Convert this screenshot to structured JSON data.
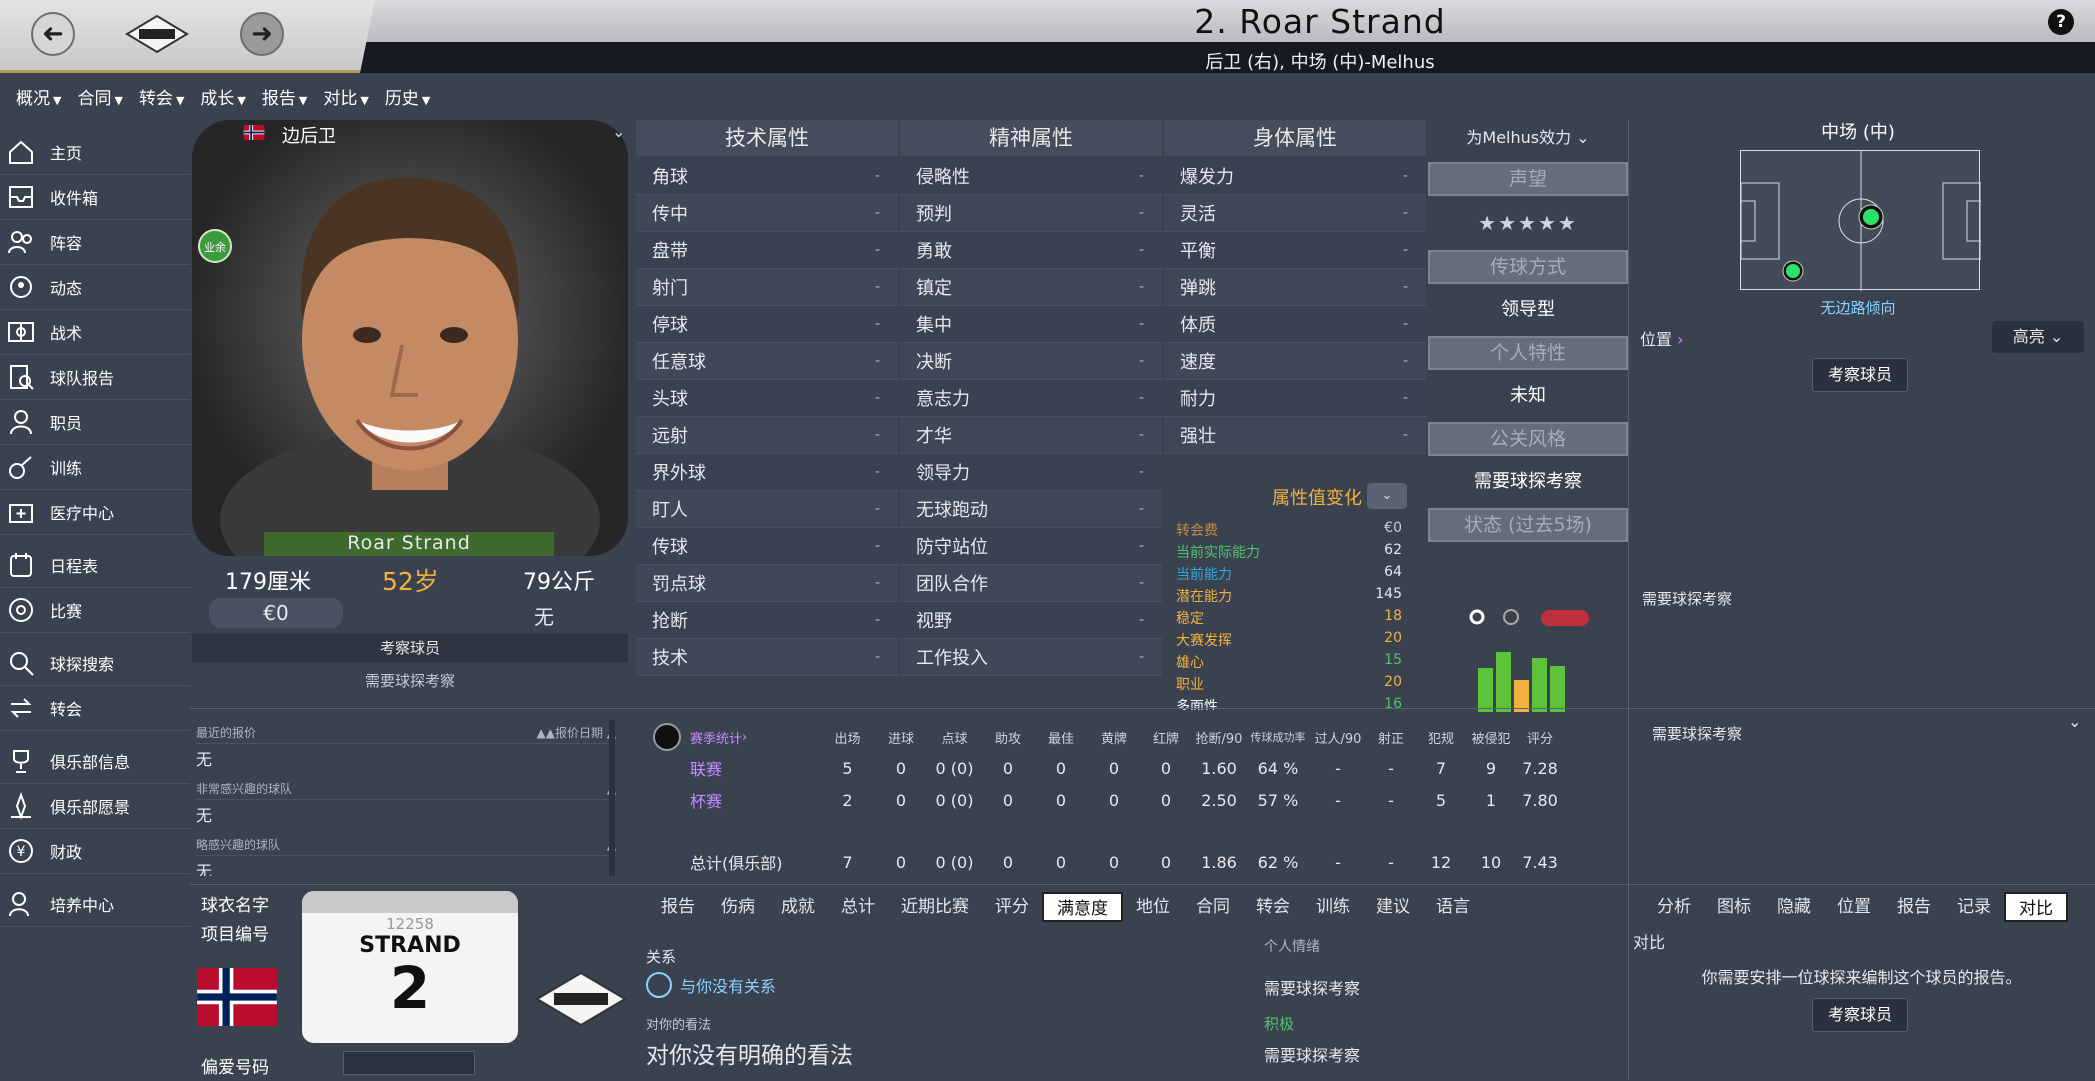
{
  "header": {
    "title": "2. Roar Strand",
    "subtitle": "后卫 (右), 中场 (中)-Melhus",
    "help": "?"
  },
  "menu": [
    {
      "label": "概况"
    },
    {
      "label": "合同"
    },
    {
      "label": "转会"
    },
    {
      "label": "成长"
    },
    {
      "label": "报告"
    },
    {
      "label": "对比"
    },
    {
      "label": "历史"
    }
  ],
  "sidebar": [
    {
      "label": "主页",
      "icon": "home-icon"
    },
    {
      "label": "收件箱",
      "icon": "inbox-icon"
    },
    {
      "label": "阵容",
      "icon": "squad-icon"
    },
    {
      "label": "动态",
      "icon": "news-icon"
    },
    {
      "label": "战术",
      "icon": "tactics-icon"
    },
    {
      "label": "球队报告",
      "icon": "report-icon"
    },
    {
      "label": "职员",
      "icon": "staff-icon"
    },
    {
      "label": "训练",
      "icon": "training-icon"
    },
    {
      "label": "医疗中心",
      "icon": "medical-icon"
    },
    {
      "label": "日程表",
      "icon": "calendar-icon"
    },
    {
      "label": "比赛",
      "icon": "match-icon"
    },
    {
      "label": "球探搜索",
      "icon": "scout-search-icon"
    },
    {
      "label": "转会",
      "icon": "transfer-icon"
    },
    {
      "label": "俱乐部信息",
      "icon": "trophy-icon"
    },
    {
      "label": "俱乐部愿景",
      "icon": "vision-icon"
    },
    {
      "label": "财政",
      "icon": "finance-icon"
    },
    {
      "label": "培养中心",
      "icon": "development-icon"
    }
  ],
  "card": {
    "role": "边后卫",
    "name": "Roar Strand",
    "amateur": "业余",
    "height": "179厘米",
    "age": "52岁",
    "weight": "79公斤",
    "value": "€0",
    "wage": "无",
    "scout_button": "考察球员",
    "need_scout": "需要球探考察"
  },
  "attributes": {
    "technical": {
      "title": "技术属性",
      "rows": [
        "角球",
        "传中",
        "盘带",
        "射门",
        "停球",
        "任意球",
        "头球",
        "远射",
        "界外球",
        "盯人",
        "传球",
        "罚点球",
        "抢断",
        "技术"
      ]
    },
    "mental": {
      "title": "精神属性",
      "rows": [
        "侵略性",
        "预判",
        "勇敢",
        "镇定",
        "集中",
        "决断",
        "意志力",
        "才华",
        "领导力",
        "无球跑动",
        "防守站位",
        "团队合作",
        "视野",
        "工作投入"
      ]
    },
    "physical": {
      "title": "身体属性",
      "rows": [
        "爆发力",
        "灵活",
        "平衡",
        "弹跳",
        "体质",
        "速度",
        "耐力",
        "强壮"
      ]
    },
    "placeholder": "-"
  },
  "attr_change": {
    "label": "属性值变化",
    "rows": [
      {
        "label": "转会费",
        "value": "€0",
        "color": "#c08a3f"
      },
      {
        "label": "当前实际能力",
        "value": "62",
        "color": "#4fc46a"
      },
      {
        "label": "当前能力",
        "value": "64",
        "color": "#2fa8e0"
      },
      {
        "label": "潜在能力",
        "value": "145",
        "color": "#f1b13f"
      },
      {
        "label": "稳定",
        "value": "18",
        "color": "#f1b13f"
      },
      {
        "label": "大赛发挥",
        "value": "20",
        "color": "#f1b13f"
      },
      {
        "label": "雄心",
        "value": "15",
        "color": "#4fc46a"
      },
      {
        "label": "职业",
        "value": "20",
        "color": "#f1b13f"
      },
      {
        "label": "多面性",
        "value": "16",
        "color": "#4fc46a"
      }
    ]
  },
  "personality": {
    "dropdown": "为Melhus效力",
    "reputation": "声望",
    "stars": "★★★★★",
    "passing_style": "传球方式",
    "leader": "领导型",
    "traits": "个人特性",
    "unknown": "未知",
    "media": "公关风格",
    "need_scout": "需要球探考察",
    "form": "状态 (过去5场)"
  },
  "position": {
    "label": "中场 (中)",
    "caption": "无边路倾向",
    "link": "位置",
    "highlight": "高亮",
    "scout_button": "考察球员",
    "need_scout": "需要球探考察"
  },
  "offers": {
    "recent_offer": "最近的报价",
    "offer_date": "报价日期",
    "none1": "无",
    "very_interested": "非常感兴趣的球队",
    "none2": "无",
    "slightly_interested": "略感兴趣的球队",
    "none3": "无"
  },
  "stats": {
    "link": "赛季统计",
    "headers": [
      "出场",
      "进球",
      "点球",
      "助攻",
      "最佳",
      "黄牌",
      "红牌",
      "抢断/90",
      "传球成功率",
      "过人/90",
      "射正",
      "犯规",
      "被侵犯",
      "评分"
    ],
    "rows": [
      {
        "name": "联赛",
        "cells": [
          "5",
          "0",
          "0 (0)",
          "0",
          "0",
          "0",
          "0",
          "1.60",
          "64 %",
          "-",
          "-",
          "7",
          "9",
          "7.28"
        ]
      },
      {
        "name": "杯赛",
        "cells": [
          "2",
          "0",
          "0 (0)",
          "0",
          "0",
          "0",
          "0",
          "2.50",
          "57 %",
          "-",
          "-",
          "5",
          "1",
          "7.80"
        ]
      },
      {
        "name": "总计(俱乐部)",
        "cells": [
          "7",
          "0",
          "0 (0)",
          "0",
          "0",
          "0",
          "0",
          "1.86",
          "62 %",
          "-",
          "-",
          "12",
          "10",
          "7.43"
        ]
      }
    ],
    "need_scout": "需要球探考察"
  },
  "bottom": {
    "shirt_name_label": "球衣名字",
    "item_number_label": "项目编号",
    "pref_number_label": "偏爱号码",
    "shirt_id": "12258",
    "shirt_name": "STRAND",
    "shirt_number": "2",
    "tabs": [
      "报告",
      "伤病",
      "成就",
      "总计",
      "近期比赛",
      "评分",
      "满意度",
      "地位",
      "合同",
      "转会",
      "训练",
      "建议",
      "语言"
    ],
    "active_tab": "满意度",
    "relation_label": "关系",
    "relation_value": "与你没有关系",
    "opinion_label": "对你的看法",
    "opinion_value": "对你没有明确的看法",
    "personal_mood": "个人情绪",
    "need_scout_a": "需要球探考察",
    "positive": "积极",
    "need_scout_b": "需要球探考察",
    "right_tabs": [
      "分析",
      "图标",
      "隐藏",
      "位置",
      "报告",
      "记录",
      "对比"
    ],
    "right_active": "对比",
    "compare_label": "对比",
    "compare_msg": "你需要安排一位球探来编制这个球员的报告。",
    "compare_button": "考察球员"
  }
}
